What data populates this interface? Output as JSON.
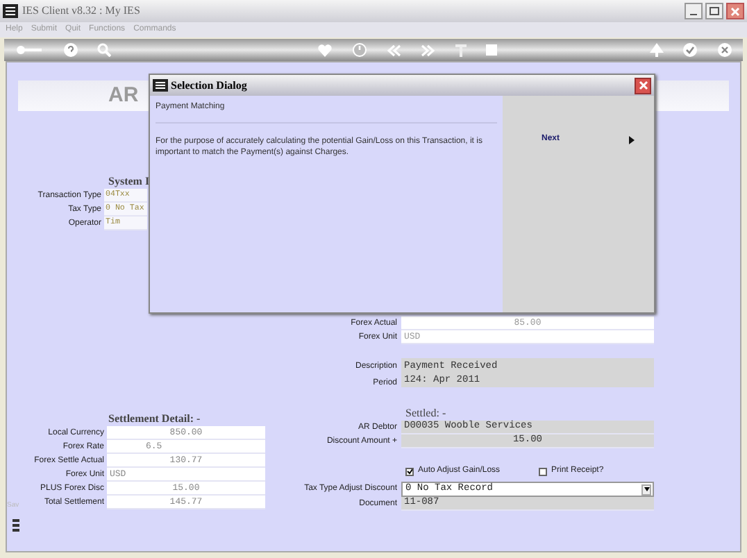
{
  "window": {
    "title": "IES Client v8.32 : My IES"
  },
  "menu": [
    "Help",
    "Submit",
    "Quit",
    "Functions",
    "Commands"
  ],
  "page": {
    "title": "AR"
  },
  "system": {
    "heading": "System I",
    "rows": [
      {
        "label": "Transaction Type",
        "value": "04Txx"
      },
      {
        "label": "Tax Type",
        "value": "0 No Tax"
      },
      {
        "label": "Operator",
        "value": "Tim"
      }
    ]
  },
  "settlement": {
    "heading": "Settlement Detail: -",
    "rows": [
      {
        "label": "Local Currency",
        "value": "850.00"
      },
      {
        "label": "Forex Rate",
        "value": "6.5"
      },
      {
        "label": "Forex Settle Actual",
        "value": "130.77"
      },
      {
        "label": "Forex Unit",
        "value": "USD"
      },
      {
        "label": "PLUS Forex Disc",
        "value": "15.00"
      },
      {
        "label": "Total Settlement",
        "value": "145.77"
      }
    ]
  },
  "forex": [
    {
      "label": "Forex Actual",
      "value": "85.00"
    },
    {
      "label": "Forex Unit",
      "value": "USD"
    }
  ],
  "description": {
    "label": "Description",
    "value": "Payment Received"
  },
  "period": {
    "label": "Period",
    "value": "124: Apr 2011"
  },
  "settled": {
    "heading": "Settled: -",
    "rows": [
      {
        "label": "AR Debtor",
        "value": "D00035 Wooble Services"
      },
      {
        "label": "Discount Amount +",
        "value": "15.00"
      }
    ]
  },
  "checkboxes": [
    {
      "label": "Auto Adjust Gain/Loss",
      "checked": true
    },
    {
      "label": "Print Receipt?",
      "checked": false
    }
  ],
  "tax_adjust": {
    "label": "Tax Type Adjust Discount",
    "value": "0 No Tax Record"
  },
  "document": {
    "label": "Document",
    "value": "11-087"
  },
  "side_label": "Sav",
  "dialog": {
    "title": "Selection Dialog",
    "heading": "Payment Matching",
    "message": "For the purpose of accurately calculating the potential Gain/Loss on this Transaction, it is important to match the Payment(s) against Charges.",
    "buttons": [
      {
        "label": "Next"
      }
    ]
  }
}
